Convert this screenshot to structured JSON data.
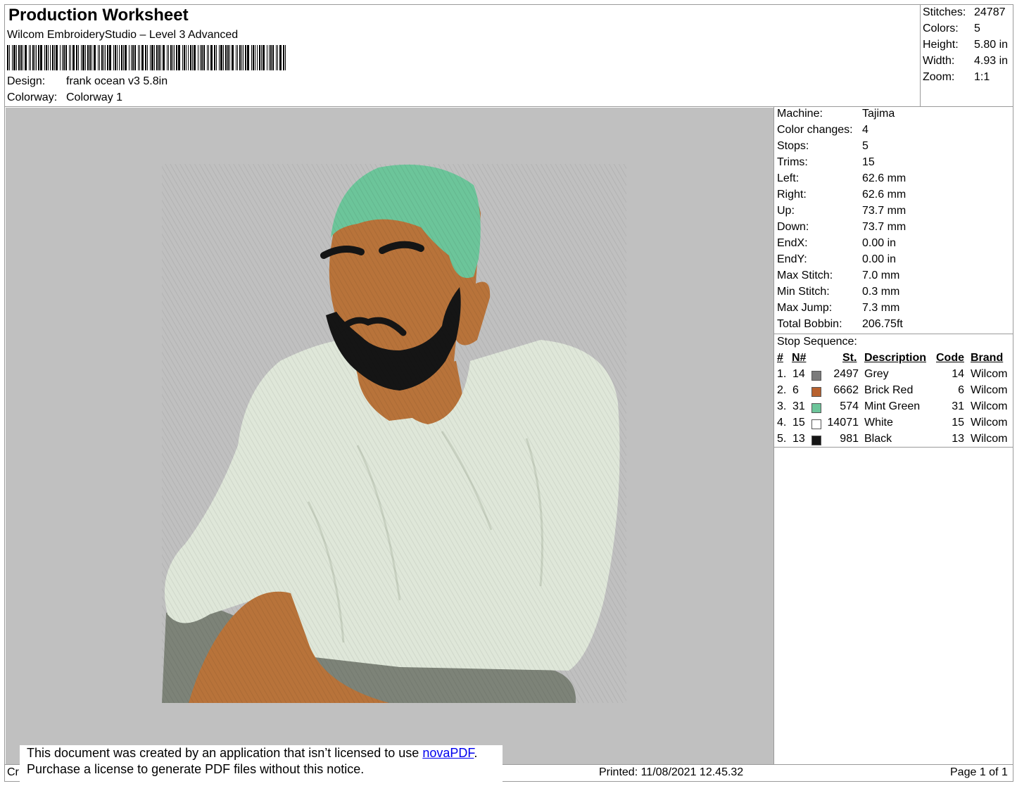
{
  "header": {
    "title": "Production Worksheet",
    "software": "Wilcom EmbroideryStudio – Level 3 Advanced",
    "design_label": "Design:",
    "design_value": "frank ocean v3 5.8in",
    "colorway_label": "Colorway:",
    "colorway_value": "Colorway 1"
  },
  "summary": [
    {
      "label": "Stitches:",
      "value": "24787"
    },
    {
      "label": "Colors:",
      "value": "5"
    },
    {
      "label": "Height:",
      "value": "5.80 in"
    },
    {
      "label": "Width:",
      "value": "4.93 in"
    },
    {
      "label": "Zoom:",
      "value": "1:1"
    }
  ],
  "machine_info": [
    {
      "label": "Machine:",
      "value": "Tajima"
    },
    {
      "label": "Color changes:",
      "value": "4"
    },
    {
      "label": "Stops:",
      "value": "5"
    },
    {
      "label": "Trims:",
      "value": "15"
    },
    {
      "label": "Left:",
      "value": "62.6 mm"
    },
    {
      "label": "Right:",
      "value": "62.6 mm"
    },
    {
      "label": "Up:",
      "value": "73.7 mm"
    },
    {
      "label": "Down:",
      "value": "73.7 mm"
    },
    {
      "label": "EndX:",
      "value": "0.00 in"
    },
    {
      "label": "EndY:",
      "value": "0.00 in"
    },
    {
      "label": "Max Stitch:",
      "value": "7.0 mm"
    },
    {
      "label": "Min Stitch:",
      "value": "0.3 mm"
    },
    {
      "label": "Max Jump:",
      "value": "7.3 mm"
    },
    {
      "label": "Total Bobbin:",
      "value": "206.75ft"
    }
  ],
  "stop_sequence": {
    "title": "Stop Sequence:",
    "headers": {
      "num": "#",
      "needle": "N#",
      "stitches": "St.",
      "description": "Description",
      "code": "Code",
      "brand": "Brand"
    },
    "rows": [
      {
        "num": "1.",
        "needle": "14",
        "color": "#7b7b7b",
        "stitches": "2497",
        "description": "Grey",
        "code": "14",
        "brand": "Wilcom"
      },
      {
        "num": "2.",
        "needle": "6",
        "color": "#b8622f",
        "stitches": "6662",
        "description": "Brick Red",
        "code": "6",
        "brand": "Wilcom"
      },
      {
        "num": "3.",
        "needle": "31",
        "color": "#6cc59a",
        "stitches": "574",
        "description": "Mint Green",
        "code": "31",
        "brand": "Wilcom"
      },
      {
        "num": "4.",
        "needle": "15",
        "color": "#ffffff",
        "stitches": "14071",
        "description": "White",
        "code": "15",
        "brand": "Wilcom"
      },
      {
        "num": "5.",
        "needle": "13",
        "color": "#151515",
        "stitches": "981",
        "description": "Black",
        "code": "13",
        "brand": "Wilcom"
      }
    ]
  },
  "notice": {
    "line1_before": "This document was created by an application that isn’t licensed to use ",
    "link": "novaPDF",
    "line1_after": ".",
    "line2": "Purchase a license to generate PDF files without this notice."
  },
  "footer": {
    "left": "Cr",
    "printed": "Printed: 11/08/2021 12.45.32",
    "page": "Page 1 of 1"
  }
}
